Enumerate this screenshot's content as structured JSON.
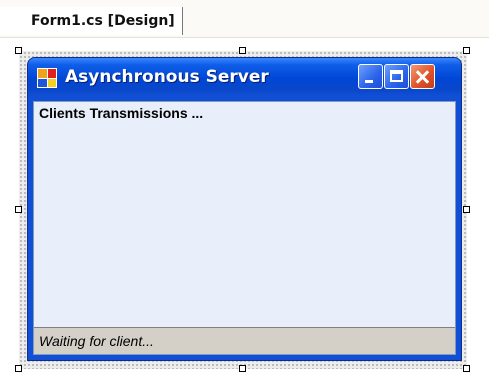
{
  "tab": {
    "label": "Form1.cs [Design]"
  },
  "form": {
    "title": "Asynchronous Server",
    "icon": "winforms-app-icon",
    "caption_buttons": [
      "minimize-icon",
      "maximize-icon",
      "close-icon"
    ],
    "log_text": "Clients Transmissions ...",
    "status_text": "Waiting for client..."
  },
  "colors": {
    "titlebar": "#0046d6",
    "client_area": "#e8effa",
    "status_bar": "#d4d0c8",
    "close_button": "#e0542a"
  }
}
